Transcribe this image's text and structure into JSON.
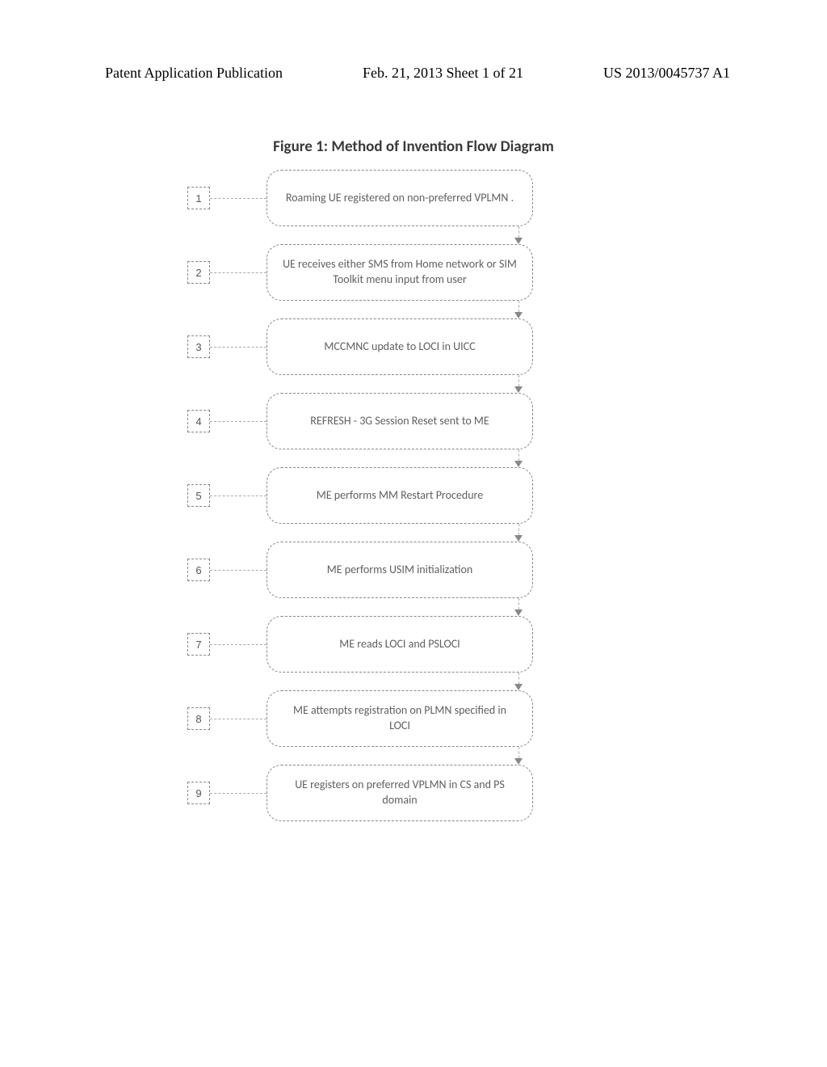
{
  "header": {
    "left": "Patent Application Publication",
    "middle": "Feb. 21, 2013  Sheet 1 of 21",
    "right": "US 2013/0045737 A1"
  },
  "figure_title": "Figure 1: Method of Invention Flow Diagram",
  "chart_data": {
    "type": "diagram",
    "title": "Figure 1: Method of Invention Flow Diagram",
    "flow": "sequential",
    "steps": [
      {
        "num": "1",
        "text": "Roaming UE registered on non-preferred VPLMN ."
      },
      {
        "num": "2",
        "text": "UE receives either SMS from Home network or SIM Toolkit menu input from user"
      },
      {
        "num": "3",
        "text": "MCCMNC update to LOCI in UICC"
      },
      {
        "num": "4",
        "text": "REFRESH - 3G Session Reset sent to ME"
      },
      {
        "num": "5",
        "text": "ME performs MM Restart Procedure"
      },
      {
        "num": "6",
        "text": "ME performs USIM initialization"
      },
      {
        "num": "7",
        "text": "ME reads LOCI and PSLOCI"
      },
      {
        "num": "8",
        "text": "ME attempts registration on PLMN specified in LOCI"
      },
      {
        "num": "9",
        "text": "UE registers on preferred VPLMN in CS and PS domain"
      }
    ]
  }
}
